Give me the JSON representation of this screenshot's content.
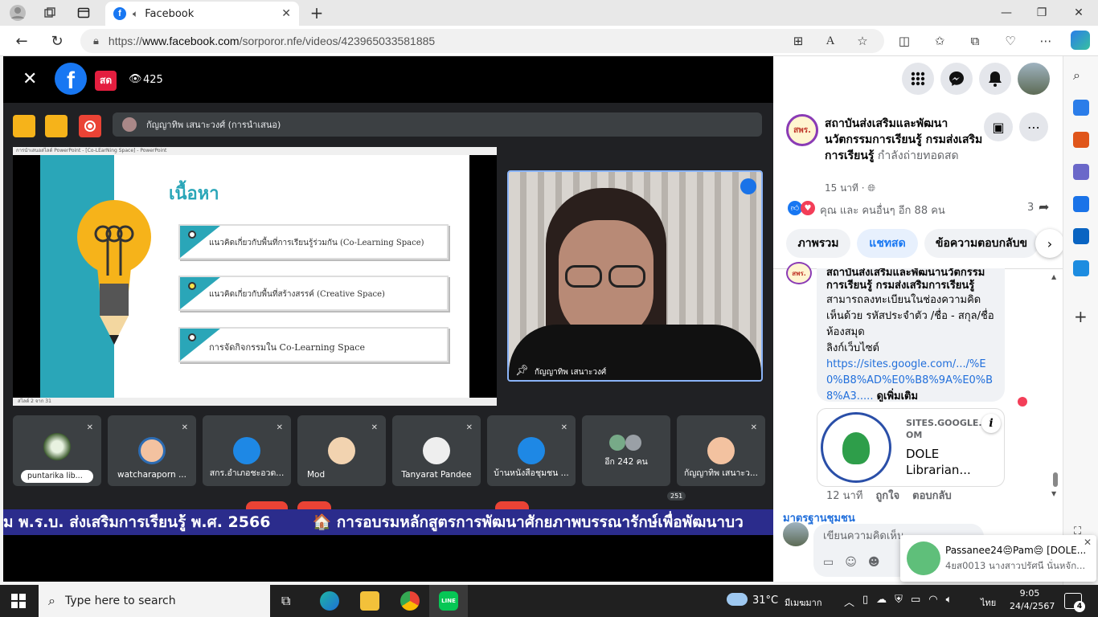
{
  "browser": {
    "tab_title": "Facebook",
    "url_prefix": "https://",
    "url_domain": "www.facebook.com",
    "url_path": "/sorporor.nfe/videos/423965033581885"
  },
  "video": {
    "live_badge": "สด",
    "viewer_count": "425",
    "presenter_label": "กัญญาทิพ เสนาะวงศ์ (การนำเสนอ)",
    "slide_window_title": "การนำเสนอสไลด์ PowerPoint - [Co-LEarNing Space] - PowerPoint",
    "slide_title": "เนื้อหา",
    "slide_items": [
      "แนวคิดเกี่ยวกับพื้นที่การเรียนรู้ร่วมกัน (Co-Learning Space)",
      "แนวคิดเกี่ยวกับพื้นที่สร้างสรรค์ (Creative Space)",
      "การจัดกิจกรรมใน Co-Learning Space"
    ],
    "slide_footer": "สไลด์ 2 จาก 31",
    "self_name": "กัญญาทิพ เสนาะวงศ์",
    "participants": [
      {
        "name": "puntarika lib..."
      },
      {
        "name": "watcharaporn ..."
      },
      {
        "name": "สกร.อำเภอชะอวด..."
      },
      {
        "name": "Mod"
      },
      {
        "name": "Tanyarat Pandee"
      },
      {
        "name": "บ้านหนังสือชุมชน ..."
      },
      {
        "name": "อีก 242 คน"
      },
      {
        "name": "กัญญาทิพ เสนาะว..."
      }
    ],
    "participant_count_badge": "251",
    "ticker_1": "ม พ.ร.บ. ส่งเสริมการเรียนรู้ พ.ศ. 2566",
    "ticker_2": "🏠 การอบรมหลักสูตรการพัฒนาศักยภาพบรรณารักษ์เพื่อพัฒนาบว"
  },
  "fb": {
    "page_name": "สถาบันส่งเสริมและพัฒนานวัตกรรมการเรียนรู้ กรมส่งเสริมการเรียนรู้",
    "live_status": "กำลังถ่ายทอดสด",
    "time_ago": "15 นาที",
    "privacy_symbol": "·",
    "reactions_text": "คุณ และ คนอื่นๆ อีก 88 คน",
    "shares": "3",
    "tabs": [
      "ภาพรวม",
      "แชทสด",
      "ข้อความตอบกลับข"
    ],
    "avatar_text": "สพร.",
    "comment_author": "สถาบันส่งเสริมและพัฒนานวัตกรรมการเรียนรู้ กรมส่งเสริมการเรียนรู้",
    "comment_text": "สามารถลงทะเบียนในช่องความคิดเห็นด้วย รหัสประจำตัว /ชื่อ - สกุล/ชื่อห้องสมุด",
    "comment_link_label": "ลิงก์เว็บไซต์",
    "comment_link": "https://sites.google.com/.../%E0%B8%AD%E0%B8%9A%E0%B8%A3.....",
    "see_more": "ดูเพิ่มเติม",
    "link_card_domain": "SITES.GOOGLE.COM",
    "link_card_title": "DOLE Librarian...",
    "comment_time": "12 นาที",
    "like_action": "ถูกใจ",
    "reply_action": "ตอบกลับ",
    "next_author": "มาตรฐานชุมชน",
    "comment_placeholder": "เขียนความคิดเห็น...",
    "popup_title": "Passanee24😔Pam😔 [DOLE...",
    "popup_sub": "4ยส0013 นางสาวปรัศนี นั่นหจัก..."
  },
  "taskbar": {
    "search_placeholder": "Type here to search",
    "weather": "31°C",
    "weather_desc": "มีเมฆมาก",
    "lang": "ไทย",
    "time": "9:05",
    "date": "24/4/2567",
    "notification_count": "4"
  },
  "colors": {
    "fb_blue": "#1877f2",
    "live_red": "#e41e3f",
    "ticker_bg": "#2b2c8c",
    "slide_teal": "#2aa6b8",
    "bulb_yellow": "#f6b31a"
  }
}
